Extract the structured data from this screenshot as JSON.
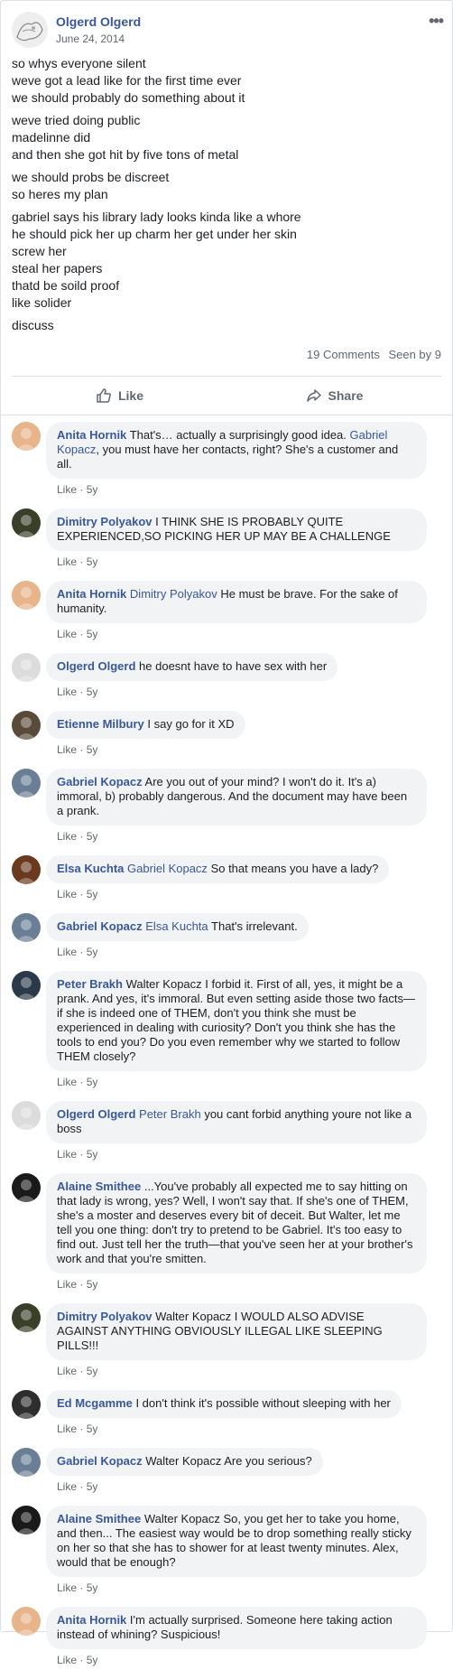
{
  "post": {
    "author": "Olgerd Olgerd",
    "date": "June 24, 2014",
    "more_label": "•••",
    "paragraphs": [
      [
        "so whys everyone silent",
        "weve got a lead like for the first time ever",
        "we should probably do something about it"
      ],
      [
        "weve tried doing public",
        "madelinne did",
        "and then she got hit by five tons of metal"
      ],
      [
        "we should probs be discreet",
        "so heres my plan"
      ],
      [
        "gabriel says his library lady looks kinda like a whore",
        "he should pick her up charm her get under her skin",
        "screw her",
        "steal her papers",
        "thatd be soild proof",
        "like solider"
      ],
      [
        "discuss"
      ]
    ],
    "comments_count": "19 Comments",
    "seen_by": "Seen by 9",
    "like_label": "Like",
    "share_label": "Share"
  },
  "comments": [
    {
      "author": "Anita Hornik",
      "mention": "",
      "text": "That's… actually a surprisingly good idea. ",
      "mention2": "Gabriel Kopacz",
      "text2": ", you must have her contacts, right? She's a customer and all.",
      "like": "Like",
      "time": "5y",
      "avatar_color": "#e8b48a"
    },
    {
      "author": "Dimitry Polyakov",
      "mention": "",
      "text": "I THINK SHE IS PROBABLY QUITE EXPERIENCED,SO PICKING HER UP MAY BE A CHALLENGE",
      "mention2": "",
      "text2": "",
      "like": "Like",
      "time": "5y",
      "avatar_color": "#3a3f2a"
    },
    {
      "author": "Anita Hornik",
      "mention": "Dimitry Polyakov",
      "text": "He must be brave. For the sake of humanity.",
      "mention2": "",
      "text2": "",
      "like": "Like",
      "time": "5y",
      "avatar_color": "#e8b48a"
    },
    {
      "author": "Olgerd Olgerd",
      "mention": "",
      "text": "he doesnt have to have sex with her",
      "mention2": "",
      "text2": "",
      "like": "Like",
      "time": "5y",
      "avatar_color": "#dcdcdc"
    },
    {
      "author": "Etienne Milbury",
      "mention": "",
      "text": "I say go for it XD",
      "mention2": "",
      "text2": "",
      "like": "Like",
      "time": "5y",
      "avatar_color": "#5a4a3a"
    },
    {
      "author": "Gabriel Kopacz",
      "mention": "",
      "text": "Are you out of your mind? I won't do it. It's a) immoral, b) probably dangerous. And the document may have been a prank.",
      "mention2": "",
      "text2": "",
      "like": "Like",
      "time": "5y",
      "avatar_color": "#6a7f96"
    },
    {
      "author": "Elsa Kuchta",
      "mention": "Gabriel Kopacz",
      "text": "So that means you have a lady?",
      "mention2": "",
      "text2": "",
      "like": "Like",
      "time": "5y",
      "avatar_color": "#6b3a1e"
    },
    {
      "author": "Gabriel Kopacz",
      "mention": "Elsa Kuchta",
      "text": "That's irrelevant.",
      "mention2": "",
      "text2": "",
      "like": "Like",
      "time": "5y",
      "avatar_color": "#6a7f96"
    },
    {
      "author": "Peter Brakh",
      "mention": "",
      "text": "Walter Kopacz I forbid it. First of all, yes, it might be a prank. And yes, it's immoral. But even setting aside those two facts—if she is indeed one of THEM, don't you think she must be experienced in dealing with curiosity? Don't you think she has the tools to end you? Do you even remember why we started to follow THEM closely?",
      "mention2": "",
      "text2": "",
      "like": "Like",
      "time": "5y",
      "avatar_color": "#2a3a4a"
    },
    {
      "author": "Olgerd Olgerd",
      "mention": "Peter Brakh",
      "text": "you cant forbid anything youre not like a boss",
      "mention2": "",
      "text2": "",
      "like": "Like",
      "time": "5y",
      "avatar_color": "#dcdcdc"
    },
    {
      "author": "Alaine Smithee",
      "mention": "",
      "text": "...You've probably all expected me to say hitting on that lady is wrong, yes? Well, I won't say that. If she's one of THEM, she's a moster and deserves every bit of deceit. But Walter, let me tell you one thing: don't try to pretend to be Gabriel. It's too easy to find out. Just tell her the truth—that you've seen her at your brother's work and that you're smitten.",
      "mention2": "",
      "text2": "",
      "like": "Like",
      "time": "5y",
      "avatar_color": "#1a1a1a"
    },
    {
      "author": "Dimitry Polyakov",
      "mention": "",
      "text": "Walter Kopacz I WOULD ALSO ADVISE AGAINST ANYTHING OBVIOUSLY ILLEGAL LIKE SLEEPING PILLS!!!",
      "mention2": "",
      "text2": "",
      "like": "Like",
      "time": "5y",
      "avatar_color": "#3a3f2a"
    },
    {
      "author": "Ed Mcgamme",
      "mention": "",
      "text": "I don't think it's possible without sleeping with her",
      "mention2": "",
      "text2": "",
      "like": "Like",
      "time": "5y",
      "avatar_color": "#2e2e2e"
    },
    {
      "author": "Gabriel Kopacz",
      "mention": "",
      "text": "Walter Kopacz Are you serious?",
      "mention2": "",
      "text2": "",
      "like": "Like",
      "time": "5y",
      "avatar_color": "#6a7f96"
    },
    {
      "author": "Alaine Smithee",
      "mention": "",
      "text": "Walter Kopacz So, you get her to take you home, and then... The easiest way would be to drop something really sticky on her so that she has to shower for at least twenty minutes. Alex, would that be enough?",
      "mention2": "",
      "text2": "",
      "like": "Like",
      "time": "5y",
      "avatar_color": "#1a1a1a"
    },
    {
      "author": "Anita Hornik",
      "mention": "",
      "text": "I'm actually surprised. Someone here taking action instead of whining? Suspicious!",
      "mention2": "",
      "text2": "",
      "like": "Like",
      "time": "5y",
      "avatar_color": "#e8b48a"
    }
  ]
}
